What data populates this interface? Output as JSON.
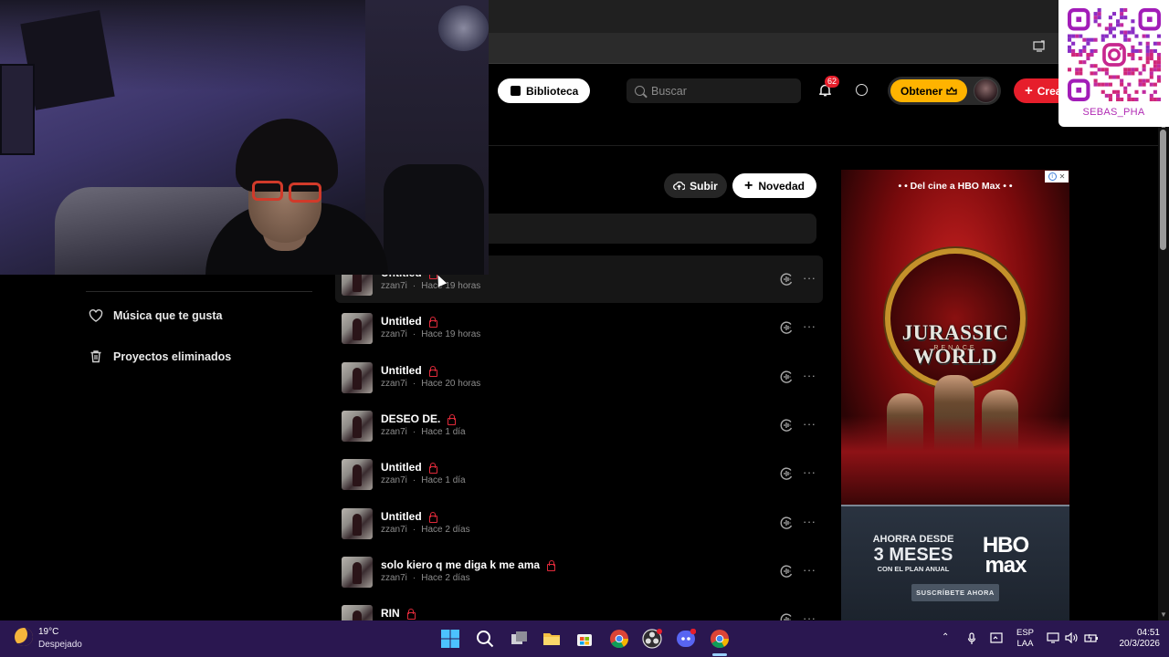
{
  "header": {
    "library_label": "Biblioteca",
    "search_placeholder": "Buscar",
    "notification_count": "62",
    "get_label": "Obtener",
    "create_label": "Crea"
  },
  "toolbar": {
    "upload_label": "Subir",
    "new_label": "Novedad"
  },
  "sidebar": {
    "items": [
      {
        "label": "Música que te gusta",
        "icon": "heart-icon"
      },
      {
        "label": "Proyectos eliminados",
        "icon": "trash-icon"
      }
    ]
  },
  "tracks": [
    {
      "title": "Untitled",
      "author": "zzan7i",
      "time": "Hace 19 horas",
      "locked": true
    },
    {
      "title": "Untitled",
      "author": "zzan7i",
      "time": "Hace 19 horas",
      "locked": true
    },
    {
      "title": "Untitled",
      "author": "zzan7i",
      "time": "Hace 20 horas",
      "locked": true
    },
    {
      "title": "DESEO DE.",
      "author": "zzan7i",
      "time": "Hace 1 día",
      "locked": true
    },
    {
      "title": "Untitled",
      "author": "zzan7i",
      "time": "Hace 1 día",
      "locked": true
    },
    {
      "title": "Untitled",
      "author": "zzan7i",
      "time": "Hace 2 días",
      "locked": true
    },
    {
      "title": "solo kiero q me diga k me ama",
      "author": "zzan7i",
      "time": "Hace 2 días",
      "locked": true
    },
    {
      "title": "RIN",
      "author": "",
      "time": "",
      "locked": true
    }
  ],
  "ad": {
    "tagline": "• • Del cine a HBO Max • •",
    "logo_title": "JURASSIC WORLD",
    "logo_sub": "RENACE",
    "offer_l1": "AHORRA DESDE",
    "offer_l2": "3 MESES",
    "offer_l3": "CON EL PLAN ANUAL",
    "brand_l1": "HBO",
    "brand_l2": "max",
    "cta": "SUSCRÍBETE AHORA"
  },
  "overlay": {
    "qr_handle": "SEBAS_PHA"
  },
  "taskbar": {
    "temperature": "19°C",
    "weather": "Despejado",
    "lang_1": "ESP",
    "lang_2": "LAA",
    "time": "04:51",
    "date": "20/3/2026"
  },
  "colors": {
    "accent_red": "#e61e2b",
    "accent_gold": "#ffb300",
    "lock_red": "#e02a3a",
    "taskbar": "#2a1750"
  }
}
